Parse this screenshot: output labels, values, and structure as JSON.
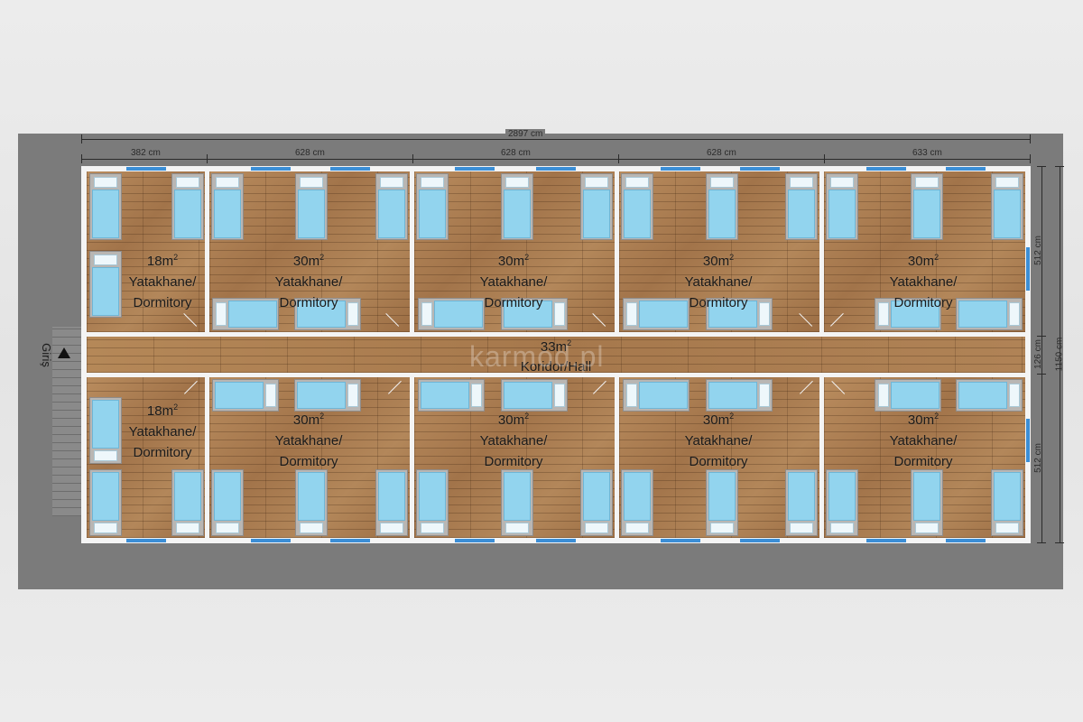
{
  "dimensions": {
    "total_width": "2897 cm",
    "segments": [
      "382 cm",
      "628 cm",
      "628 cm",
      "628 cm",
      "633 cm"
    ],
    "top_depth": "512 cm",
    "corridor_depth": "126 cm",
    "total_depth": "1150 cm",
    "bottom_depth": "512 cm"
  },
  "rooms": {
    "small": {
      "area": "18m",
      "sup": "2",
      "line1": "Yatakhane/",
      "line2": "Dormitory"
    },
    "large": {
      "area": "30m",
      "sup": "2",
      "line1": "Yatakhane/",
      "line2": "Dormitory"
    }
  },
  "corridor": {
    "area": "33m",
    "sup": "2",
    "name": "Koridor/Hall"
  },
  "entrance": {
    "label": "Giriş"
  },
  "watermark": "karmod.pl",
  "colors": {
    "floor": "#a97d52",
    "mattress": "#92d4ee",
    "window": "#3b8ed6",
    "slab": "#7b7b7b"
  }
}
